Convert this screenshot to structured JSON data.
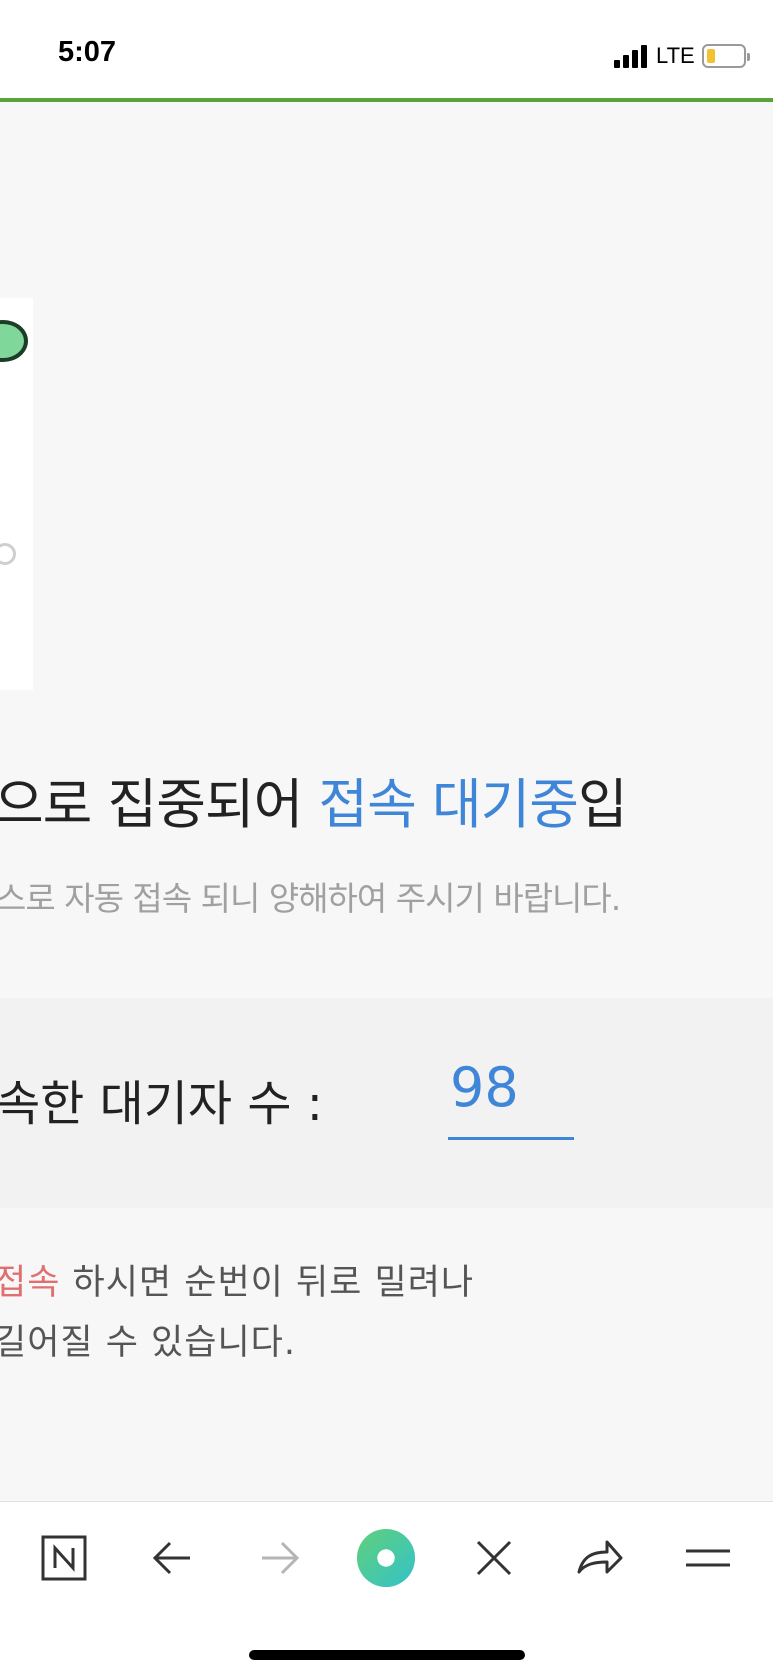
{
  "status_bar": {
    "time": "5:07",
    "network": "LTE"
  },
  "waiting": {
    "headline_prefix": "으로 집중되어 ",
    "headline_accent": "접속 대기중",
    "headline_suffix": "입",
    "subline": "스로 자동 접속 되니 양해하여 주시기 바랍니다.",
    "count_label": "속한 대기자 수 :",
    "count_value": "98",
    "notice_line1_accent": "접속",
    "notice_line1_rest": " 하시면 순번이 뒤로 밀려나",
    "notice_line2": "길어질 수 있습니다."
  },
  "toolbar": {
    "icons": [
      "naver-n-icon",
      "back-arrow-icon",
      "forward-arrow-icon",
      "green-dot-icon",
      "close-icon",
      "share-icon",
      "menu-icon"
    ]
  },
  "colors": {
    "accent": "#3f86d8",
    "brand_green": "#5aa23a",
    "bg": "#f7f7f7"
  }
}
